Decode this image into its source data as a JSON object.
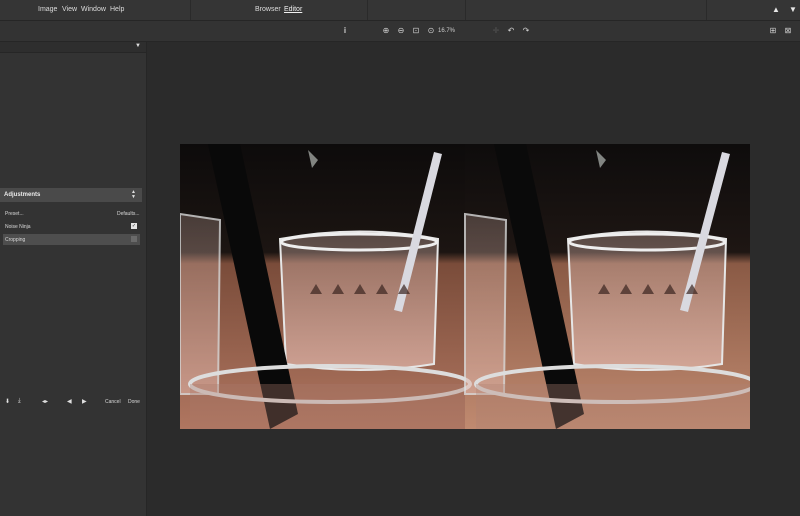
{
  "menubar": {
    "items": [
      "Image",
      "View",
      "Window",
      "Help"
    ],
    "modes": [
      "Browser",
      "Editor"
    ],
    "active_mode": "Editor"
  },
  "toolbar": {
    "zoom": "16.7%"
  },
  "left_panel": {
    "adjustments_title": "Adjustments",
    "preset_label": "Preset...",
    "defaults_label": "Defaults...",
    "adjustments": [
      {
        "label": "Noise Ninja",
        "enabled": true
      },
      {
        "label": "Cropping",
        "enabled": false
      }
    ],
    "cancel_label": "Cancel",
    "done_label": "Done"
  },
  "colors": {
    "menubar_bg": "#353535",
    "panel_bg": "#333333",
    "canvas_bg": "#2b2b2b",
    "selection_bg": "#4e4e4e"
  }
}
